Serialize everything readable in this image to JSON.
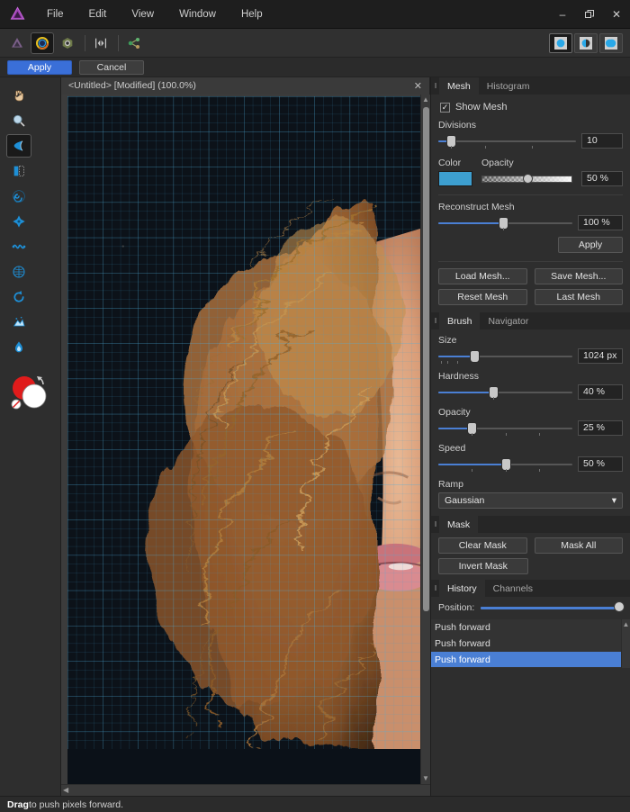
{
  "window": {
    "minimize_label": "–",
    "maximize_label": "❐",
    "close_label": "✕",
    "logo_name": "affinity-photo-logo"
  },
  "menu": {
    "items": [
      {
        "label": "File"
      },
      {
        "label": "Edit"
      },
      {
        "label": "View"
      },
      {
        "label": "Window"
      },
      {
        "label": "Help"
      }
    ]
  },
  "toolbar": {
    "personas": [
      {
        "name": "photo-persona",
        "active": false
      },
      {
        "name": "liquify-persona",
        "active": true
      },
      {
        "name": "develop-persona",
        "active": false
      },
      {
        "name": "tone-mapping-persona",
        "active": false
      },
      {
        "name": "export-persona",
        "active": false
      }
    ],
    "view_modes": [
      {
        "name": "single-view",
        "active": true
      },
      {
        "name": "split-view",
        "active": false
      },
      {
        "name": "mirror-view",
        "active": false
      }
    ]
  },
  "command_bar": {
    "apply_label": "Apply",
    "cancel_label": "Cancel"
  },
  "tools": {
    "items": [
      {
        "name": "hand-tool",
        "active": false
      },
      {
        "name": "zoom-tool",
        "active": false
      },
      {
        "name": "liquify-push-forward-tool",
        "active": true
      },
      {
        "name": "liquify-push-left-tool",
        "active": false
      },
      {
        "name": "liquify-twirl-tool",
        "active": false
      },
      {
        "name": "liquify-pinch-punch-tool",
        "active": false
      },
      {
        "name": "liquify-turbulence-tool",
        "active": false
      },
      {
        "name": "liquify-mesh-clone-tool",
        "active": false
      },
      {
        "name": "liquify-reconstruct-tool",
        "active": false
      },
      {
        "name": "liquify-freeze-tool",
        "active": false
      },
      {
        "name": "liquify-thaw-tool",
        "active": false
      }
    ],
    "color_widget": {
      "name": "foreground-background-color",
      "foreground": "#e01b1b",
      "background": "#ffffff"
    }
  },
  "document": {
    "tab_title": "<Untitled> [Modified] (100.0%)",
    "close_label": "✕"
  },
  "mesh_panel": {
    "tabs": [
      {
        "label": "Mesh",
        "active": true
      },
      {
        "label": "Histogram",
        "active": false
      }
    ],
    "show_mesh_label": "Show Mesh",
    "show_mesh_checked": true,
    "check_glyph": "✓",
    "divisions_label": "Divisions",
    "divisions_value": "10",
    "divisions_pct": 9,
    "color_label": "Color",
    "color_value": "#3d9fd0",
    "opacity_label": "Opacity",
    "opacity_value": "50 %",
    "opacity_pct": 50,
    "reconstruct_label": "Reconstruct Mesh",
    "reconstruct_value": "100 %",
    "reconstruct_pct": 48,
    "apply_label": "Apply",
    "load_mesh_label": "Load Mesh...",
    "save_mesh_label": "Save Mesh...",
    "reset_mesh_label": "Reset Mesh",
    "last_mesh_label": "Last Mesh"
  },
  "brush_panel": {
    "tabs": [
      {
        "label": "Brush",
        "active": true
      },
      {
        "label": "Navigator",
        "active": false
      }
    ],
    "size_label": "Size",
    "size_value": "1024 px",
    "size_pct": 27,
    "hardness_label": "Hardness",
    "hardness_value": "40 %",
    "hardness_pct": 41,
    "opacity_label": "Opacity",
    "opacity_value": "25 %",
    "opacity_pct": 25,
    "speed_label": "Speed",
    "speed_value": "50 %",
    "speed_pct": 50,
    "ramp_label": "Ramp",
    "ramp_value": "Gaussian",
    "chevron": "▾"
  },
  "mask_panel": {
    "tabs": [
      {
        "label": "Mask",
        "active": true
      }
    ],
    "clear_mask_label": "Clear Mask",
    "mask_all_label": "Mask All",
    "invert_mask_label": "Invert Mask"
  },
  "history_panel": {
    "tabs": [
      {
        "label": "History",
        "active": true
      },
      {
        "label": "Channels",
        "active": false
      }
    ],
    "position_label": "Position:",
    "position_pct": 100,
    "entries": [
      {
        "label": "Push forward",
        "selected": false
      },
      {
        "label": "Push forward",
        "selected": false
      },
      {
        "label": "Push forward",
        "selected": true
      }
    ]
  },
  "status_bar": {
    "hint_bold": "Drag",
    "hint_rest": " to push pixels forward."
  },
  "colors": {
    "accent": "#4a7fd4",
    "panel_bg": "#2e2e2e",
    "canvas_bg": "#3c3c3c",
    "mesh_color": "#3d9fd0"
  }
}
